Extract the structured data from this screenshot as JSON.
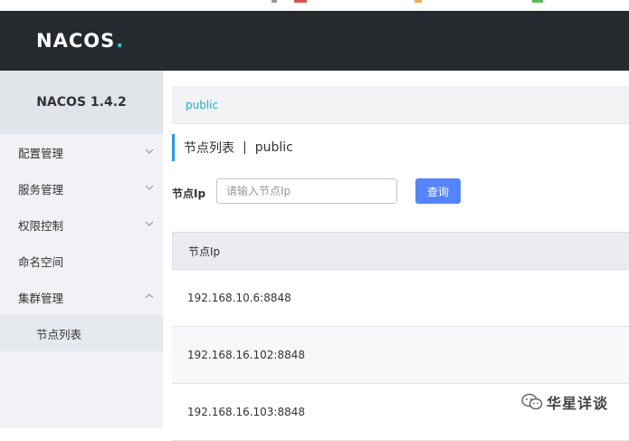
{
  "header": {
    "logo_text": "NACOS",
    "logo_dot": ".",
    "top_strip_colors": [
      "#d9534f",
      "#f0ad4e",
      "#5cb85c"
    ]
  },
  "sidebar": {
    "version": "NACOS 1.4.2",
    "items": [
      {
        "label": "配置管理",
        "icon": "chevron-down-icon"
      },
      {
        "label": "服务管理",
        "icon": "chevron-down-icon"
      },
      {
        "label": "权限控制",
        "icon": "chevron-down-icon"
      },
      {
        "label": "命名空间"
      },
      {
        "label": "集群管理",
        "icon": "chevron-up-icon"
      }
    ],
    "sub_items": [
      {
        "label": "节点列表"
      }
    ]
  },
  "main": {
    "namespace_link": "public",
    "title": "节点列表",
    "title_separator": "|",
    "title_namespace": "public",
    "search": {
      "label": "节点Ip",
      "placeholder": "请输入节点Ip",
      "value": "",
      "button_label": "查询"
    },
    "table": {
      "columns": [
        "节点Ip"
      ],
      "rows": [
        {
          "ip": "192.168.10.6:8848"
        },
        {
          "ip": "192.168.16.102:8848"
        },
        {
          "ip": "192.168.16.103:8848"
        }
      ]
    }
  },
  "watermark": {
    "text": "华星详谈",
    "icon": "wechat-icon"
  },
  "colors": {
    "header_bg": "#252a2f",
    "accent_cyan": "#2ac7d1",
    "primary_button": "#5584ff",
    "link": "#1bb1cf",
    "title_mark": "#209bfa"
  }
}
